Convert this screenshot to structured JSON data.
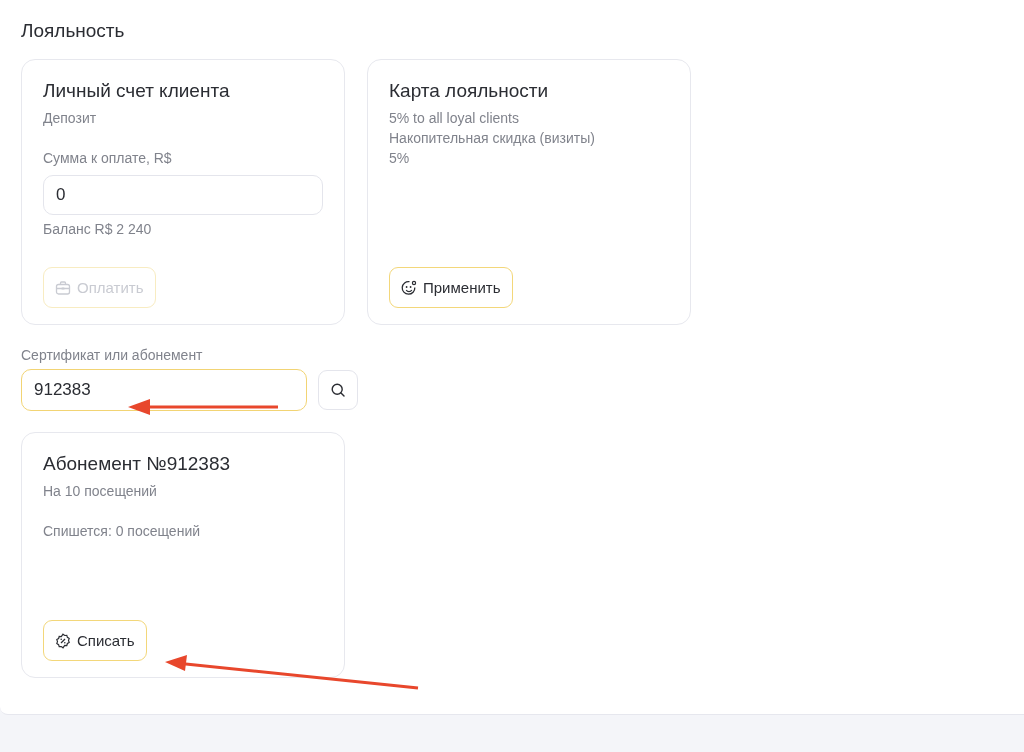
{
  "section_title": "Лояльность",
  "deposit_card": {
    "title": "Личный счет клиента",
    "subtitle": "Депозит",
    "amount_label": "Сумма к оплате, R$",
    "amount_value": "0",
    "balance": "Баланс R$ 2 240",
    "pay_button": {
      "label": "Оплатить",
      "disabled": true
    }
  },
  "loyalty_card": {
    "title": "Карта лояльности",
    "lines": [
      "5% to all loyal clients",
      "Накопительная скидка (визиты)",
      "5%"
    ],
    "apply_button": {
      "label": "Применить",
      "disabled": false
    }
  },
  "certificate_search": {
    "label": "Сертификат или абонемент",
    "value": "912383",
    "focused": true
  },
  "subscription_card": {
    "title": "Абонемент №912383",
    "subtitle": "На 10 посещений",
    "charge_info": "Спишется: 0 посещений",
    "charge_button": {
      "label": "Списать",
      "disabled": false
    }
  }
}
